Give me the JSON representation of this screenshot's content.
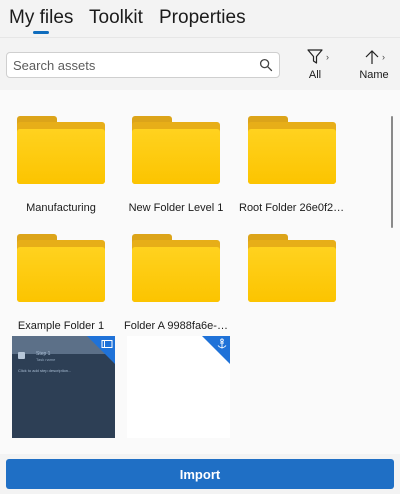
{
  "tabs": [
    {
      "label": "My files",
      "active": true
    },
    {
      "label": "Toolkit",
      "active": false
    },
    {
      "label": "Properties",
      "active": false
    }
  ],
  "search": {
    "placeholder": "Search assets",
    "value": "",
    "icon": "search-icon"
  },
  "toolbar": {
    "filter": {
      "label": "All",
      "icon": "filter-icon"
    },
    "sort": {
      "label": "Name",
      "icon": "arrow-up-icon"
    }
  },
  "items": [
    {
      "type": "folder",
      "label": "Manufacturing"
    },
    {
      "type": "folder",
      "label": "New Folder Level 1"
    },
    {
      "type": "folder",
      "label": "Root Folder 26e0f22..."
    },
    {
      "type": "folder",
      "label": "Example Folder 1"
    },
    {
      "type": "folder",
      "label": "Folder A 9988fa6e-3..."
    },
    {
      "type": "folder",
      "label": ""
    },
    {
      "type": "guide-thumbnail",
      "badge_icon": "panel-icon",
      "preview": {
        "step_title": "Step 1",
        "step_name": "Task name",
        "step_placeholder": "Click to add step description..."
      }
    },
    {
      "type": "anchor-thumbnail",
      "badge_icon": "anchor-icon"
    }
  ],
  "footer": {
    "import_label": "Import"
  },
  "colors": {
    "accent": "#1f6fc5",
    "folder": "#fcc400",
    "folder_tab": "#dca419",
    "badge": "#1f72d8",
    "thumb_dark": "#2d3f55"
  }
}
